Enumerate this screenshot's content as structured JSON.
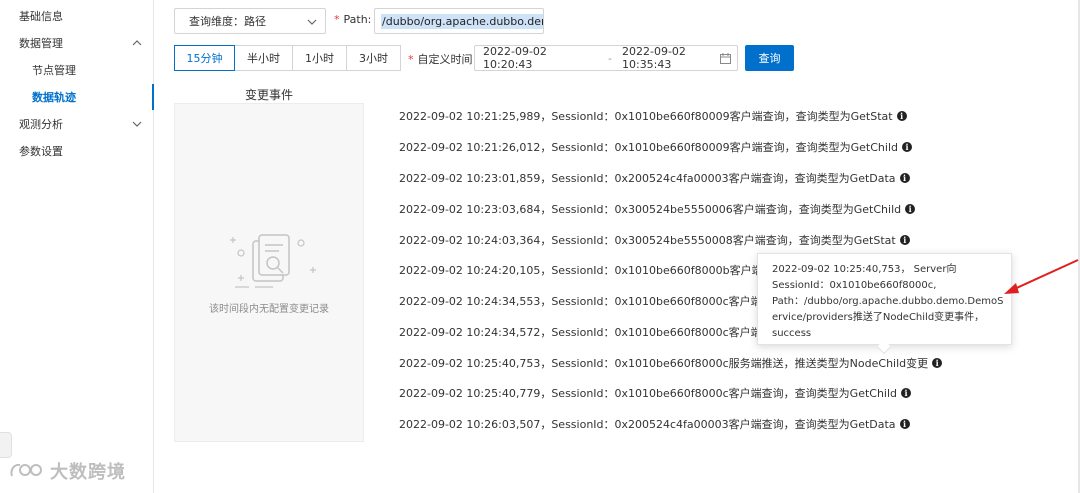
{
  "sidebar": {
    "items": [
      {
        "label": "基础信息"
      },
      {
        "label": "数据管理"
      },
      {
        "label": "节点管理"
      },
      {
        "label": "数据轨迹"
      },
      {
        "label": "观测分析"
      },
      {
        "label": "参数设置"
      }
    ],
    "watermark": "大数跨境"
  },
  "toolbar": {
    "dimension_select": "查询维度：路径",
    "path_label": "Path:",
    "path_value": "/dubbo/org.apache.dubbo.dem",
    "required_mark": "*",
    "range_tabs": [
      "15分钟",
      "半小时",
      "1小时",
      "3小时"
    ],
    "custom_time_label": "自定义时间",
    "start_time": "2022-09-02 10:20:43",
    "separator": "-",
    "end_time": "2022-09-02 10:35:43",
    "query_button": "查询"
  },
  "events_panel": {
    "title": "变更事件",
    "empty_text": "该时间段内无配置变更记录"
  },
  "logs": [
    "2022-09-02 10:21:25,989，SessionId：0x1010be660f80009客户端查询，查询类型为GetStat",
    "2022-09-02 10:21:26,012，SessionId：0x1010be660f80009客户端查询，查询类型为GetChild",
    "2022-09-02 10:23:01,859，SessionId：0x200524c4fa00003客户端查询，查询类型为GetData",
    "2022-09-02 10:23:03,684，SessionId：0x300524be5550006客户端查询，查询类型为GetChild",
    "2022-09-02 10:24:03,364，SessionId：0x300524be5550008客户端查询，查询类型为GetStat",
    "2022-09-02 10:24:20,105，SessionId：0x1010be660f8000b客户端查询，查",
    "2022-09-02 10:24:34,553，SessionId：0x1010be660f8000c客户端查询，查",
    "2022-09-02 10:24:34,572，SessionId：0x1010be660f8000c客户端查询，查",
    "2022-09-02 10:25:40,753，SessionId：0x1010be660f8000c服务端推送，推送类型为NodeChild变更",
    "2022-09-02 10:25:40,779，SessionId：0x1010be660f8000c客户端查询，查询类型为GetChild",
    "2022-09-02 10:26:03,507，SessionId：0x200524c4fa00003客户端查询，查询类型为GetData"
  ],
  "tooltip": {
    "lines": [
      "2022-09-02 10:25:40,753， Server向",
      "SessionId：0x1010be660f8000c,",
      "Path：/dubbo/org.apache.dubbo.demo.DemoS",
      "ervice/providers推送了NodeChild变更事件，",
      "success"
    ]
  },
  "colors": {
    "accent": "#0070cc",
    "required": "#e53935",
    "annotation_arrow": "#e02020"
  }
}
